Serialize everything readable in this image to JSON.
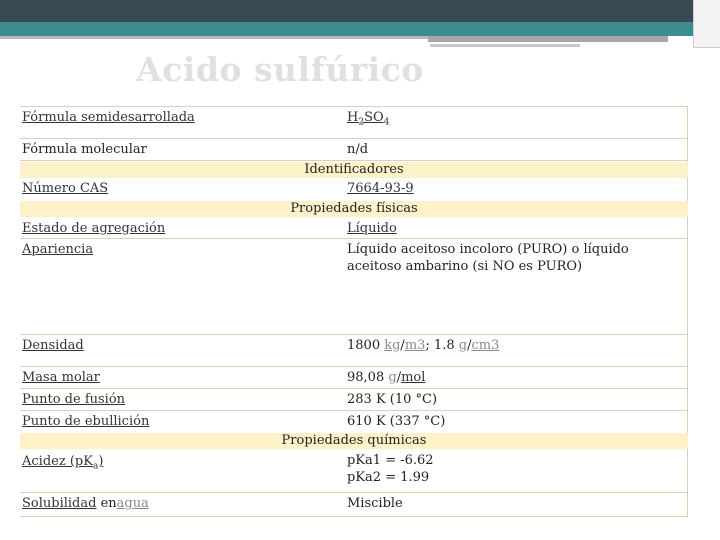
{
  "title": "Acido sulfúrico",
  "rows": {
    "formula_semi": {
      "label": "Fórmula semidesarrollada",
      "value_main": "H",
      "sub1": "2",
      "value_mid": "SO",
      "sub2": "4"
    },
    "formula_mol": {
      "label": "Fórmula molecular",
      "value": "n/d"
    },
    "identificadores": "Identificadores",
    "cas": {
      "label": "Número CAS",
      "value": "7664-93-9"
    },
    "prop_fisicas": "Propiedades físicas",
    "estado": {
      "label": "Estado de agregación",
      "value": "Líquido"
    },
    "apariencia": {
      "label": "Apariencia",
      "value": "Líquido aceitoso incoloro (PURO) o líquido aceitoso ambarino (si NO es PURO)"
    },
    "densidad": {
      "label": "Densidad",
      "v1": "1800 ",
      "kg": "kg",
      "s1": "/",
      "m3": "m3",
      "v2": "; 1.8 ",
      "g": "g",
      "s2": "/",
      "cm3": "cm3"
    },
    "masa": {
      "label": "Masa molar",
      "v1": "98,08 ",
      "g": "g",
      "s": "/",
      "mol": "mol"
    },
    "fusion": {
      "label": "Punto de fusión",
      "value": "283 K (10 °C)"
    },
    "ebullicion": {
      "label": "Punto de ebullición",
      "value": "610 K (337 °C)"
    },
    "prop_quimicas": "Propiedades químicas",
    "acidez": {
      "label": "Acidez (pK",
      "sub": "a",
      "label_end": ")",
      "value1": "pKa1 = -6.62",
      "value2": "pKa2 = 1.99"
    },
    "solubilidad": {
      "label1": "Solubilidad",
      "label2": " en",
      "label3": "agua",
      "value": "Miscible"
    }
  }
}
